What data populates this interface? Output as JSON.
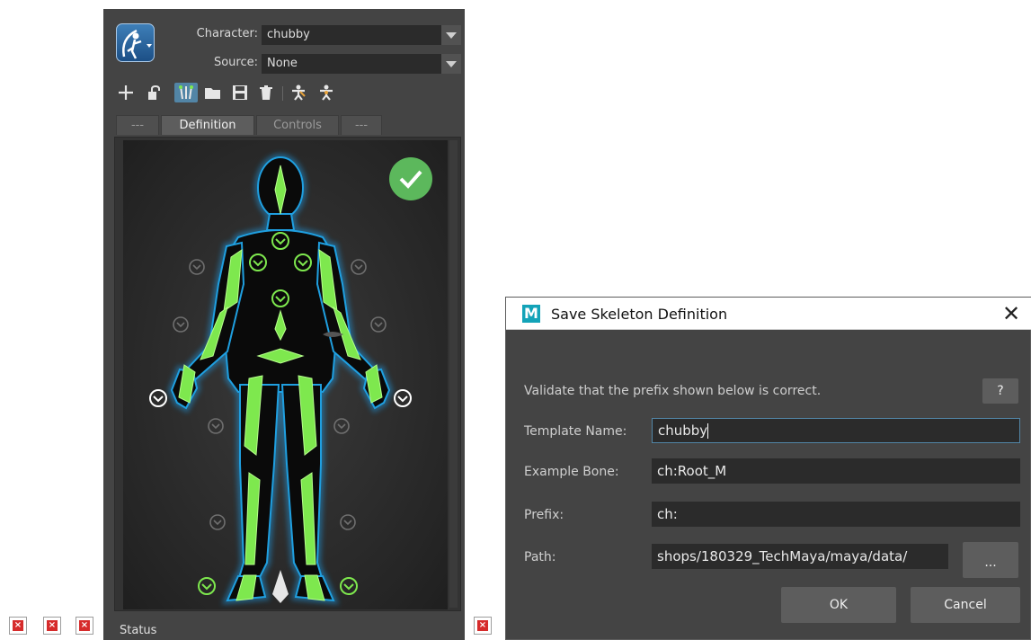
{
  "hik_panel": {
    "character_label": "Character:",
    "character_value": "chubby",
    "source_label": "Source:",
    "source_value": "None",
    "toolbar": [
      "add-icon",
      "unlock-icon",
      "skeleton-mode-icon",
      "open-folder-icon",
      "save-icon",
      "delete-icon",
      "character-icon",
      "character-alt-icon"
    ],
    "tabs": [
      "---",
      "Definition",
      "Controls",
      "---"
    ],
    "active_tab": "Definition",
    "status_label": "Status",
    "validation": "check-icon"
  },
  "dialog": {
    "title": "Save Skeleton Definition",
    "app_logo": "M",
    "message": "Validate that the prefix shown below is correct.",
    "help_label": "?",
    "template_name_label": "Template Name:",
    "template_name_value": "chubby",
    "example_bone_label": "Example Bone:",
    "example_bone_value": "ch:Root_M",
    "prefix_label": "Prefix:",
    "prefix_value": "ch:",
    "path_label": "Path:",
    "path_value": "shops/180329_TechMaya/maya/data/",
    "browse_label": "...",
    "ok_label": "OK",
    "cancel_label": "Cancel"
  },
  "colors": {
    "panel_bg": "#444444",
    "accent": "#5285a6",
    "bone_green": "#7ee84e",
    "outline_blue": "#1f9fe0",
    "check_green": "#5cb85c"
  }
}
